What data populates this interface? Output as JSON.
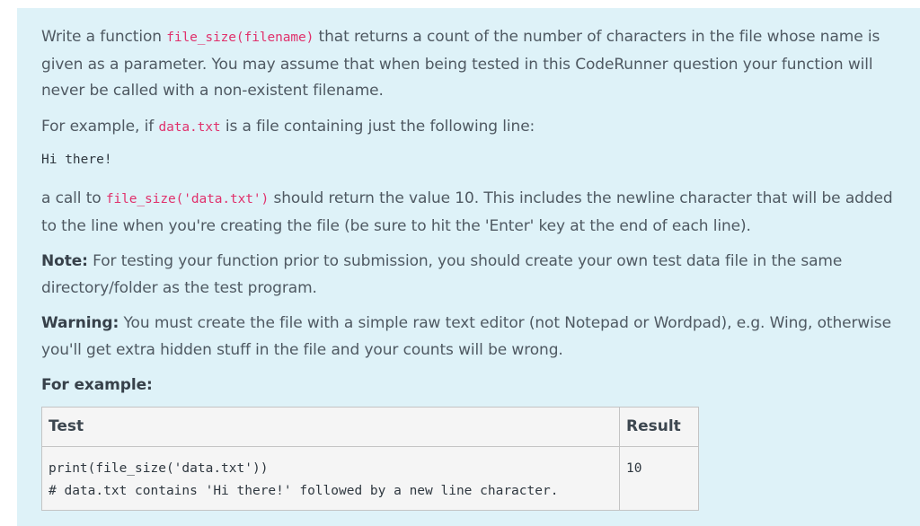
{
  "question": {
    "p1": {
      "before": "Write a function ",
      "code": "file_size(filename)",
      "after": " that returns a count of the number of characters in the file whose name is given as a parameter. You may assume that when being tested in this CodeRunner question your function will never be called with a non-existent filename."
    },
    "p2": {
      "before": "For example, if ",
      "code": "data.txt",
      "after": " is a file containing just the following line:"
    },
    "sample_line": "Hi there!",
    "p4": {
      "before": "a call to ",
      "code": "file_size('data.txt')",
      "after": " should return the value 10. This includes the newline character that will be added to the line when you're creating the file (be sure to hit the 'Enter' key at the end of each line)."
    },
    "note": {
      "label": "Note:",
      "text": " For testing your function prior to submission, you should create your own test data file in the same directory/folder as the test program."
    },
    "warning": {
      "label": "Warning:",
      "text": " You must create the file with a simple raw text editor (not Notepad or Wordpad), e.g. Wing, otherwise you'll get extra hidden stuff in the file and your counts will be wrong."
    },
    "for_example": "For example:"
  },
  "examples_table": {
    "headers": {
      "test": "Test",
      "result": "Result"
    },
    "rows": [
      {
        "test": "print(file_size('data.txt'))\n# data.txt contains 'Hi there!' followed by a new line character.",
        "result": "10"
      }
    ]
  }
}
